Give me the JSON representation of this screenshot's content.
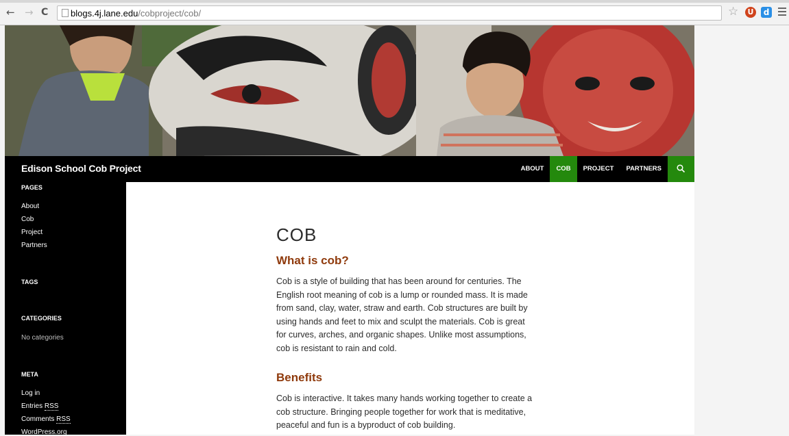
{
  "browser": {
    "url_host": "blogs.4j.lane.edu",
    "url_path": "/cobproject/cob/",
    "back_icon": "←",
    "forward_icon": "→",
    "reload_icon": "C",
    "star_icon": "☆",
    "ext1_icon": "U",
    "ext2_icon": "d"
  },
  "site": {
    "title": "Edison School Cob Project",
    "nav": [
      "About",
      "Cob",
      "Project",
      "Partners"
    ],
    "active_nav": "Cob",
    "accent_color": "#24890d"
  },
  "sidebar": {
    "pages_title": "Pages",
    "pages": [
      "About",
      "Cob",
      "Project",
      "Partners"
    ],
    "tags_title": "Tags",
    "categories_title": "Categories",
    "no_categories": "No categories",
    "meta_title": "Meta",
    "meta_login": "Log in",
    "meta_entries": "Entries",
    "meta_comments": "Comments",
    "meta_rss": "RSS",
    "meta_wordpress": "WordPress.org"
  },
  "article": {
    "title": "COB",
    "heading1": "What is cob?",
    "para1": "Cob is a style of building that has been around for centuries.  The English root meaning of cob is a lump or rounded mass. It is made from sand, clay, water, straw and earth.  Cob structures are built by using hands and feet to mix and sculpt the materials. Cob is great for curves, arches, and organic shapes. Unlike most assumptions, cob is resistant to rain and cold.",
    "heading2": "Benefits",
    "para2": "Cob is interactive.  It takes many hands working together to create a cob structure.  Bringing people together for work that is meditative, peaceful and fun is a byproduct of cob building."
  }
}
